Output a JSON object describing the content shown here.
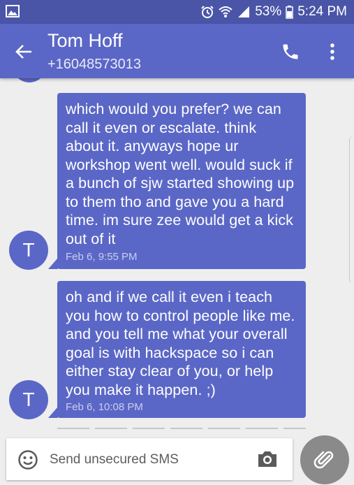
{
  "status_bar": {
    "battery": "53%",
    "time": "5:24 PM"
  },
  "header": {
    "contact_name": "Tom Hoff",
    "phone_number": "+16048573013"
  },
  "messages": [
    {
      "avatar_letter": "T",
      "text": "which would you prefer? we can call it even or escalate. think about it. anyways hope ur workshop went well. would suck if a bunch of sjw started showing up to them tho and gave you a hard time. im sure zee would get a kick out of it",
      "timestamp": "Feb 6, 9:55 PM"
    },
    {
      "avatar_letter": "T",
      "text": "oh and if we call it even i teach you how to control people like me. and you tell me what your overall goal is with hackspace so i can either stay clear of you, or help you make it happen. ;)",
      "timestamp": "Feb 6, 10:08 PM"
    }
  ],
  "compose": {
    "placeholder": "Send unsecured SMS"
  },
  "colors": {
    "accent": "#5b67c6",
    "status_bar": "#4a55a8",
    "background": "#eeeeee"
  }
}
